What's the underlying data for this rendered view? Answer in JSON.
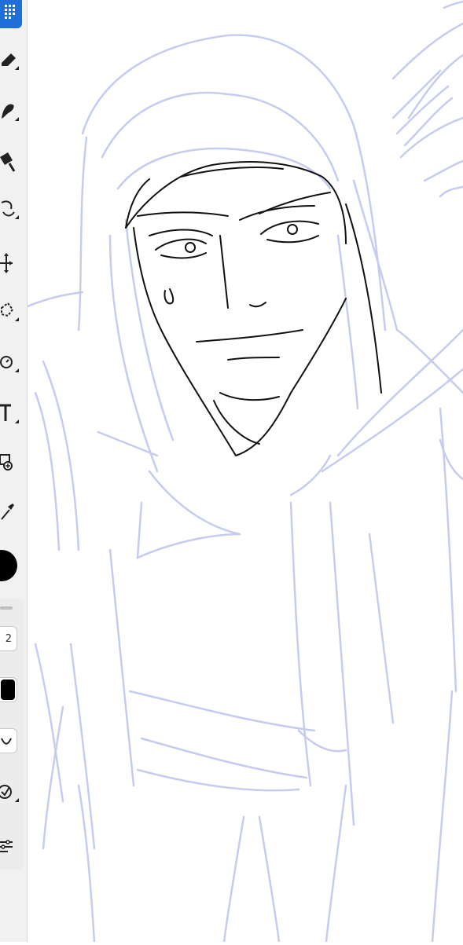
{
  "app": {
    "toolbar": {
      "tools": [
        {
          "name": "selection-tool-icon",
          "active": true
        },
        {
          "name": "eraser-tool-icon",
          "has_submenu": true
        },
        {
          "name": "blend-tool-icon",
          "has_submenu": true
        },
        {
          "name": "fill-tool-icon"
        },
        {
          "name": "transform-tool-icon",
          "has_submenu": true
        },
        {
          "name": "move-tool-icon"
        },
        {
          "name": "lasso-tool-icon",
          "has_submenu": true
        },
        {
          "name": "rotate-tool-icon",
          "has_submenu": true
        },
        {
          "name": "text-tool-icon",
          "has_submenu": true
        },
        {
          "name": "add-image-tool-icon"
        },
        {
          "name": "eyedropper-tool-icon"
        }
      ],
      "active_color": "#000000",
      "accent_color": "#1e6fd9"
    },
    "properties": {
      "brush_size": "2",
      "brush_color": "#000000",
      "stroke_style_icon": "curve-icon",
      "stabilizer_icon": "stabilizer-icon",
      "settings_icon": "sliders-icon"
    },
    "canvas": {
      "sketch_color": "#c5ccf0",
      "ink_color": "#111111"
    }
  }
}
